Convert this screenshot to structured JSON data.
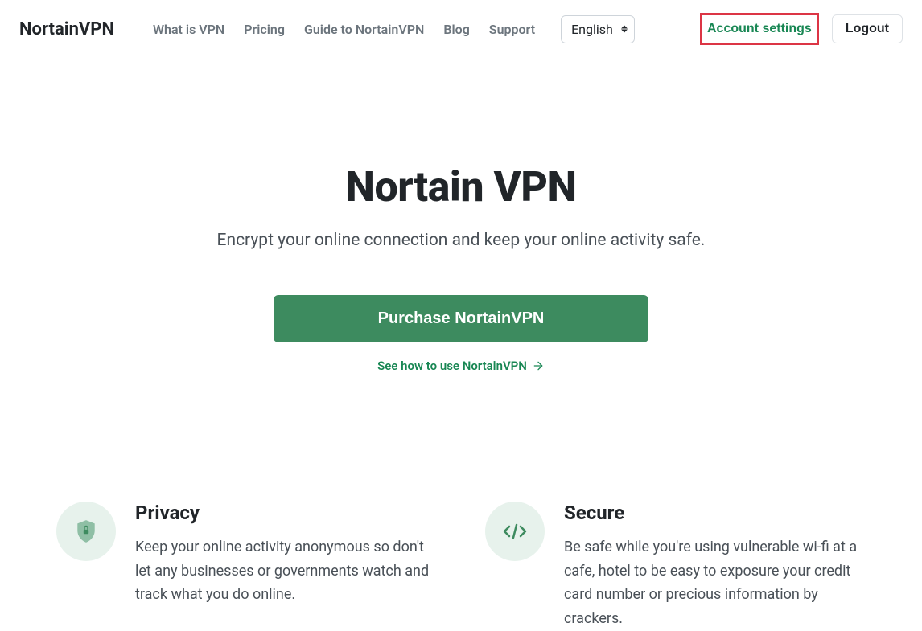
{
  "nav": {
    "brand": "NortainVPN",
    "links": {
      "what_is_vpn": "What is VPN",
      "pricing": "Pricing",
      "guide": "Guide to NortainVPN",
      "blog": "Blog",
      "support": "Support"
    },
    "language_selected": "English",
    "account_settings": "Account settings",
    "logout": "Logout"
  },
  "hero": {
    "title": "Nortain VPN",
    "subtitle": "Encrypt your online connection and keep your online activity safe.",
    "purchase_label": "Purchase NortainVPN",
    "howto_label": "See how to use NortainVPN"
  },
  "features": {
    "privacy": {
      "title": "Privacy",
      "desc": "Keep your online activity anonymous so don't let any businesses or governments watch and track what you do online."
    },
    "secure": {
      "title": "Secure",
      "desc": "Be safe while you're using vulnerable wi-fi at a cafe, hotel to be easy to exposure your credit card number or precious information by crackers."
    }
  },
  "colors": {
    "accent": "#198754",
    "highlight_border": "#dc3545"
  }
}
